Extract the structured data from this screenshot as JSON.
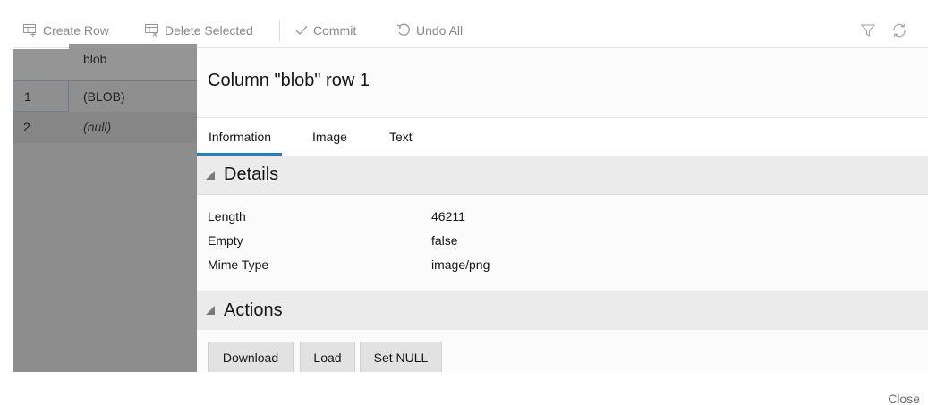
{
  "toolbar": {
    "create_row": "Create Row",
    "delete_selected": "Delete Selected",
    "commit": "Commit",
    "undo_all": "Undo All",
    "icons": {
      "create_row": "table-add-row-icon",
      "delete_selected": "table-delete-row-icon",
      "commit": "checkmark-icon",
      "undo_all": "undo-icon",
      "filter": "filter-icon",
      "refresh": "refresh-icon"
    }
  },
  "grid": {
    "column_header": "blob",
    "rows": [
      {
        "num": "1",
        "value": "(BLOB)"
      },
      {
        "num": "2",
        "value": "(null)"
      }
    ]
  },
  "panel": {
    "title": "Column \"blob\" row 1",
    "tabs": [
      {
        "label": "Information",
        "active": true
      },
      {
        "label": "Image",
        "active": false
      },
      {
        "label": "Text",
        "active": false
      }
    ],
    "details": {
      "heading": "Details",
      "rows": [
        {
          "key": "Length",
          "value": "46211"
        },
        {
          "key": "Empty",
          "value": "false"
        },
        {
          "key": "Mime Type",
          "value": "image/png"
        }
      ]
    },
    "actions": {
      "heading": "Actions",
      "buttons": [
        "Download",
        "Load",
        "Set NULL"
      ]
    }
  },
  "footer": {
    "close": "Close"
  },
  "colors": {
    "accent": "#227ec3",
    "grid_overlay": "#8d8d8d",
    "section_bg": "#ebebeb"
  }
}
